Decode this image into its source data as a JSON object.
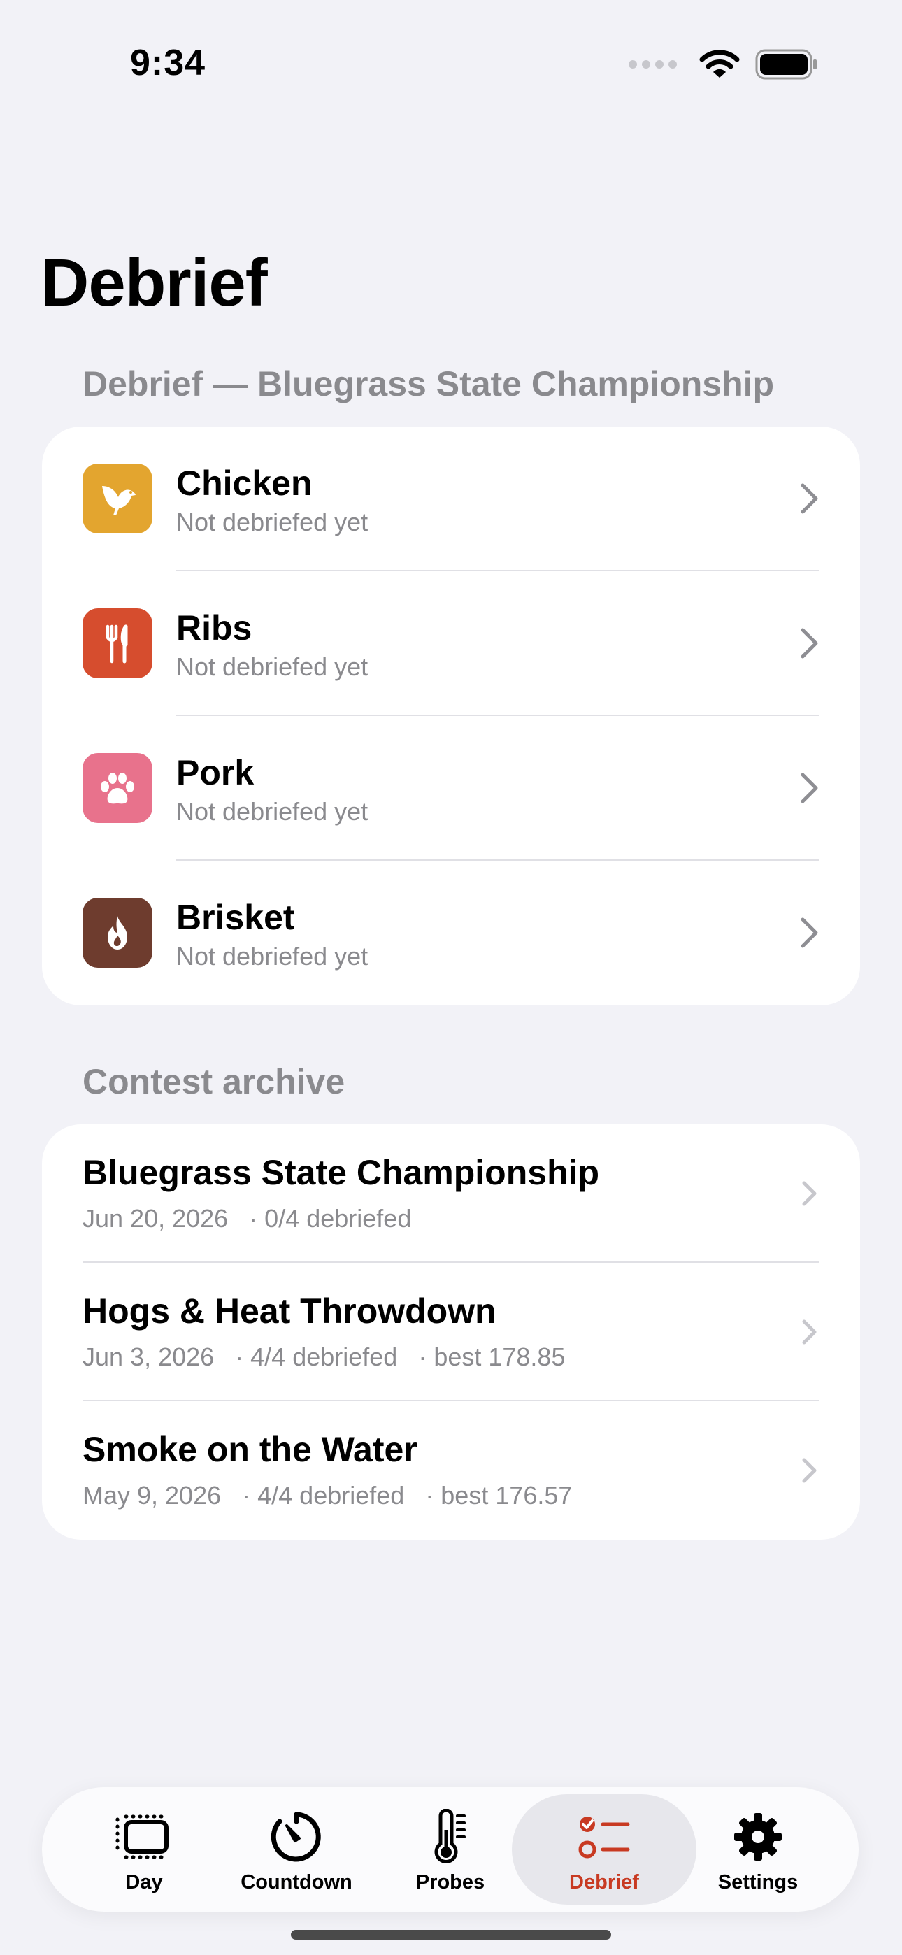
{
  "status_bar": {
    "time": "9:34"
  },
  "page_title": "Debrief",
  "categories_section": {
    "header": "Debrief — Bluegrass State Championship",
    "items": [
      {
        "title": "Chicken",
        "subtitle": "Not debriefed yet",
        "icon": "bird-icon",
        "color": "#e3a52f"
      },
      {
        "title": "Ribs",
        "subtitle": "Not debriefed yet",
        "icon": "fork-knife-icon",
        "color": "#d64d2e"
      },
      {
        "title": "Pork",
        "subtitle": "Not debriefed yet",
        "icon": "paw-icon",
        "color": "#e8728c"
      },
      {
        "title": "Brisket",
        "subtitle": "Not debriefed yet",
        "icon": "flame-icon",
        "color": "#6e3c2e"
      }
    ]
  },
  "archive_section": {
    "header": "Contest archive",
    "items": [
      {
        "title": "Bluegrass State Championship",
        "meta": "Jun 20, 2026   · 0/4 debriefed"
      },
      {
        "title": "Hogs & Heat Throwdown",
        "meta": "Jun 3, 2026   · 4/4 debriefed   · best 178.85"
      },
      {
        "title": "Smoke on the Water",
        "meta": "May 9, 2026   · 4/4 debriefed   · best 176.57"
      }
    ]
  },
  "tab_bar": {
    "active_color": "#c83a22",
    "tabs": [
      {
        "label": "Day",
        "icon": "day-icon"
      },
      {
        "label": "Countdown",
        "icon": "timer-icon"
      },
      {
        "label": "Probes",
        "icon": "thermometer-icon"
      },
      {
        "label": "Debrief",
        "icon": "checklist-icon",
        "active": true
      },
      {
        "label": "Settings",
        "icon": "gear-icon"
      }
    ]
  }
}
